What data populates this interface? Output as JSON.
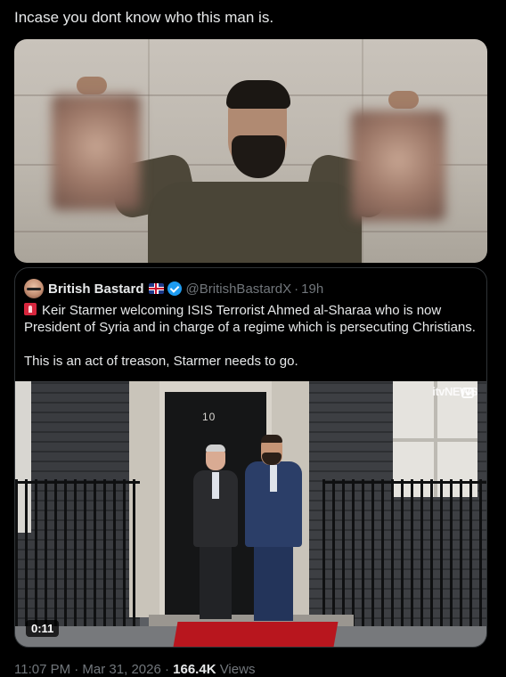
{
  "post": {
    "text": "Incase you dont know who this man is.",
    "media": {
      "type": "image",
      "description_icon": "photo"
    }
  },
  "quote": {
    "display_name": "British Bastard",
    "flag_icon": "uk-flag-icon",
    "verified_icon": "verified-badge-icon",
    "handle": "@BritishBastardX",
    "separator": "·",
    "time": "19h",
    "alert_icon": "siren-icon",
    "body_line1": "Keir Starmer welcoming ISIS Terrorist Ahmed al-Sharaa who is now President of Syria and in charge of a regime which is persecuting Christians.",
    "body_line2": "This is an act of treason, Starmer needs to go.",
    "video": {
      "door_number": "10",
      "watermark": "itvNEWS",
      "duration": "0:11"
    }
  },
  "meta": {
    "timestamp": "11:07 PM · Mar 31, 2026 ·",
    "views_count": "166.4K",
    "views_label": "Views"
  },
  "colors": {
    "background": "#000000",
    "text": "#e7e9ea",
    "secondary_text": "#71767b",
    "border": "#2f3336",
    "verified": "#1d9bf0"
  }
}
